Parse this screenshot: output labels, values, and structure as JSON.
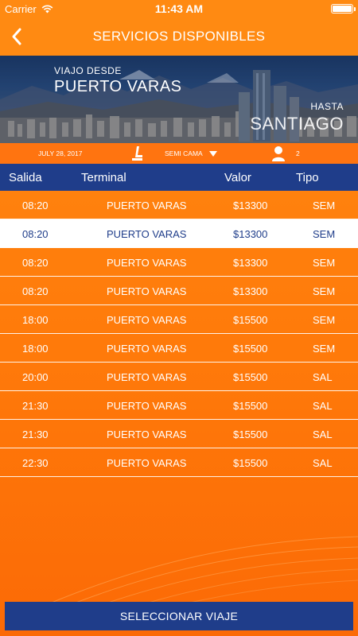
{
  "status_bar": {
    "carrier": "Carrier",
    "time": "11:43 AM",
    "battery_level": 1.0
  },
  "header": {
    "title": "SERVICIOS DISPONIBLES",
    "back_icon": "chevron-left-icon"
  },
  "trip": {
    "from_label": "VIAJO DESDE",
    "from_city": "PUERTO VARAS",
    "to_label": "HASTA",
    "to_city": "SANTIAGO"
  },
  "info_bar": {
    "date": "JULY 28, 2017",
    "seat_type": "SEMI CAMA",
    "passengers": "2",
    "seat_icon": "seat-icon",
    "person_icon": "person-icon"
  },
  "table": {
    "headers": {
      "salida": "Salida",
      "terminal": "Terminal",
      "valor": "Valor",
      "tipo": "Tipo"
    },
    "rows": [
      {
        "time": "08:20",
        "terminal": "PUERTO VARAS",
        "price": "$13300",
        "type": "SEM"
      },
      {
        "time": "08:20",
        "terminal": "PUERTO VARAS",
        "price": "$13300",
        "type": "SEM"
      },
      {
        "time": "08:20",
        "terminal": "PUERTO VARAS",
        "price": "$13300",
        "type": "SEM"
      },
      {
        "time": "08:20",
        "terminal": "PUERTO VARAS",
        "price": "$13300",
        "type": "SEM"
      },
      {
        "time": "18:00",
        "terminal": "PUERTO VARAS",
        "price": "$15500",
        "type": "SEM"
      },
      {
        "time": "18:00",
        "terminal": "PUERTO VARAS",
        "price": "$15500",
        "type": "SEM"
      },
      {
        "time": "20:00",
        "terminal": "PUERTO VARAS",
        "price": "$15500",
        "type": "SAL"
      },
      {
        "time": "21:30",
        "terminal": "PUERTO VARAS",
        "price": "$15500",
        "type": "SAL"
      },
      {
        "time": "21:30",
        "terminal": "PUERTO VARAS",
        "price": "$15500",
        "type": "SAL"
      },
      {
        "time": "22:30",
        "terminal": "PUERTO VARAS",
        "price": "$15500",
        "type": "SAL"
      }
    ],
    "selected_index": 1
  },
  "footer": {
    "select_button": "SELECCIONAR VIAJE"
  },
  "colors": {
    "orange": "#ff8a12",
    "navy": "#1f3d8a",
    "white": "#ffffff"
  }
}
